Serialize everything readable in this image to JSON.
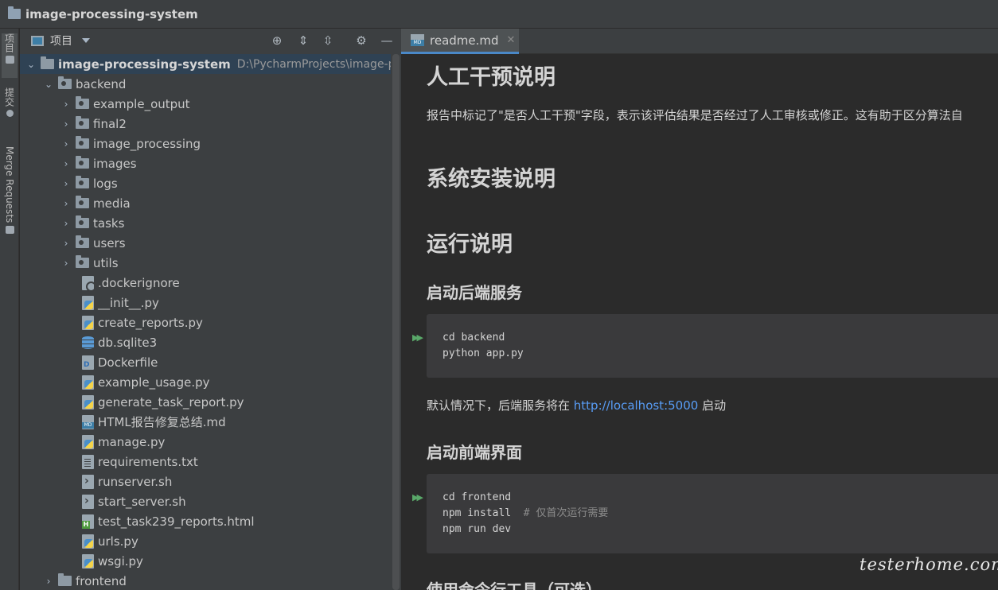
{
  "window": {
    "title": "image-processing-system"
  },
  "stripe": {
    "project_label": "项目",
    "commit_label": "提交",
    "merge_label": "Merge Requests"
  },
  "project_panel": {
    "view_label": "项目",
    "toolbar_icons": [
      "locate-icon",
      "expand-all-icon",
      "collapse-all-icon",
      "gear-icon",
      "minimize-icon"
    ]
  },
  "tree": {
    "root": {
      "name": "image-processing-system",
      "path": "D:\\PycharmProjects\\image-pro"
    },
    "backend": "backend",
    "folders": [
      "example_output",
      "final2",
      "image_processing",
      "images",
      "logs",
      "media",
      "tasks",
      "users",
      "utils"
    ],
    "files": [
      {
        "name": ".dockerignore",
        "icon": "ign"
      },
      {
        "name": "__init__.py",
        "icon": "py"
      },
      {
        "name": "create_reports.py",
        "icon": "py"
      },
      {
        "name": "db.sqlite3",
        "icon": "db"
      },
      {
        "name": "Dockerfile",
        "icon": "docker"
      },
      {
        "name": "example_usage.py",
        "icon": "py"
      },
      {
        "name": "generate_task_report.py",
        "icon": "py"
      },
      {
        "name": "HTML报告修复总结.md",
        "icon": "md"
      },
      {
        "name": "manage.py",
        "icon": "py"
      },
      {
        "name": "requirements.txt",
        "icon": "txt"
      },
      {
        "name": "runserver.sh",
        "icon": "sh"
      },
      {
        "name": "start_server.sh",
        "icon": "sh"
      },
      {
        "name": "test_task239_reports.html",
        "icon": "html"
      },
      {
        "name": "urls.py",
        "icon": "py"
      },
      {
        "name": "wsgi.py",
        "icon": "py"
      }
    ],
    "frontend": "frontend"
  },
  "editor": {
    "tab": "readme.md",
    "h_intervention": "人工干预说明",
    "p_intervention": "报告中标记了\"是否人工干预\"字段，表示该评估结果是否经过了人工审核或修正。这有助于区分算法自",
    "h_install": "系统安装说明",
    "h_run": "运行说明",
    "h_backend": "启动后端服务",
    "code_backend": [
      "cd backend",
      "python app.py"
    ],
    "p_backend_before": "默认情况下，后端服务将在 ",
    "p_backend_link": "http://localhost:5000",
    "p_backend_after": " 启动",
    "h_frontend": "启动前端界面",
    "code_frontend_1": "cd frontend",
    "code_frontend_2_cmd": "npm install  ",
    "code_frontend_2_cmt": "# 仅首次运行需要",
    "code_frontend_3": "npm run dev",
    "h_cli": "使用命令行工具（可选）"
  },
  "watermark": "testerhome.com"
}
